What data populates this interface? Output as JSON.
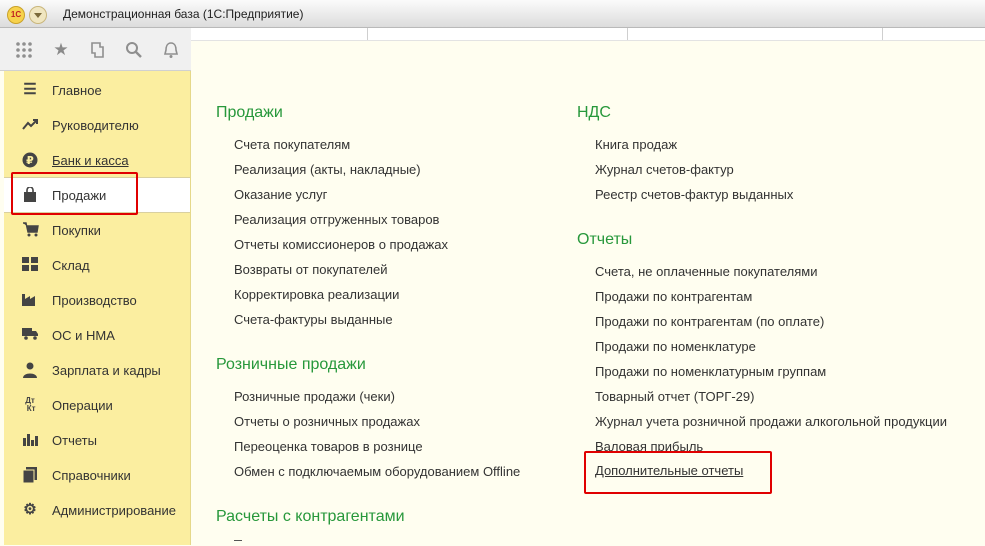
{
  "window": {
    "title": "Демонстрационная база  (1С:Предприятие)",
    "logo": "1С"
  },
  "toolbar": {
    "icons": [
      "apps-grid-icon",
      "star-icon",
      "history-icon",
      "search-icon",
      "bell-icon"
    ]
  },
  "sidebar": {
    "items": [
      {
        "label": "Главное",
        "icon": "menu-lines-icon"
      },
      {
        "label": "Руководителю",
        "icon": "trend-up-icon"
      },
      {
        "label": "Банк и касса",
        "icon": "ruble-coin-icon"
      },
      {
        "label": "Продажи",
        "icon": "shopping-bag-icon"
      },
      {
        "label": "Покупки",
        "icon": "cart-icon"
      },
      {
        "label": "Склад",
        "icon": "warehouse-grid-icon"
      },
      {
        "label": "Производство",
        "icon": "factory-icon"
      },
      {
        "label": "ОС и НМА",
        "icon": "truck-icon"
      },
      {
        "label": "Зарплата и кадры",
        "icon": "person-icon"
      },
      {
        "label": "Операции",
        "icon": "debit-credit-icon"
      },
      {
        "label": "Отчеты",
        "icon": "bar-chart-icon"
      },
      {
        "label": "Справочники",
        "icon": "books-icon"
      },
      {
        "label": "Администрирование",
        "icon": "gear-icon"
      }
    ],
    "active": "Продажи"
  },
  "main": {
    "sales": {
      "title": "Продажи",
      "links": [
        "Счета покупателям",
        "Реализация (акты, накладные)",
        "Оказание услуг",
        "Реализация отгруженных товаров",
        "Отчеты комиссионеров о продажах",
        "Возвраты от покупателей",
        "Корректировка реализации",
        "Счета-фактуры выданные"
      ]
    },
    "retail": {
      "title": "Розничные продажи",
      "links": [
        "Розничные продажи (чеки)",
        "Отчеты о розничных продажах",
        "Переоценка товаров в рознице",
        "Обмен с подключаемым оборудованием Offline"
      ]
    },
    "settlements": {
      "title": "Расчеты с контрагентами"
    },
    "vat": {
      "title": "НДС",
      "links": [
        "Книга продаж",
        "Журнал счетов-фактур",
        "Реестр счетов-фактур выданных"
      ]
    },
    "reports": {
      "title": "Отчеты",
      "links": [
        "Счета, не оплаченные покупателями",
        "Продажи по контрагентам",
        "Продажи по контрагентам (по оплате)",
        "Продажи по номенклатуре",
        "Продажи по номенклатурным группам",
        "Товарный отчет (ТОРГ-29)",
        "Журнал учета розничной продажи алкогольной продукции",
        "Валовая прибыль",
        "Дополнительные отчеты"
      ]
    }
  },
  "colors": {
    "section_green": "#27983b",
    "sidebar_bg": "#fbeea0",
    "highlight_red": "#e00000"
  }
}
